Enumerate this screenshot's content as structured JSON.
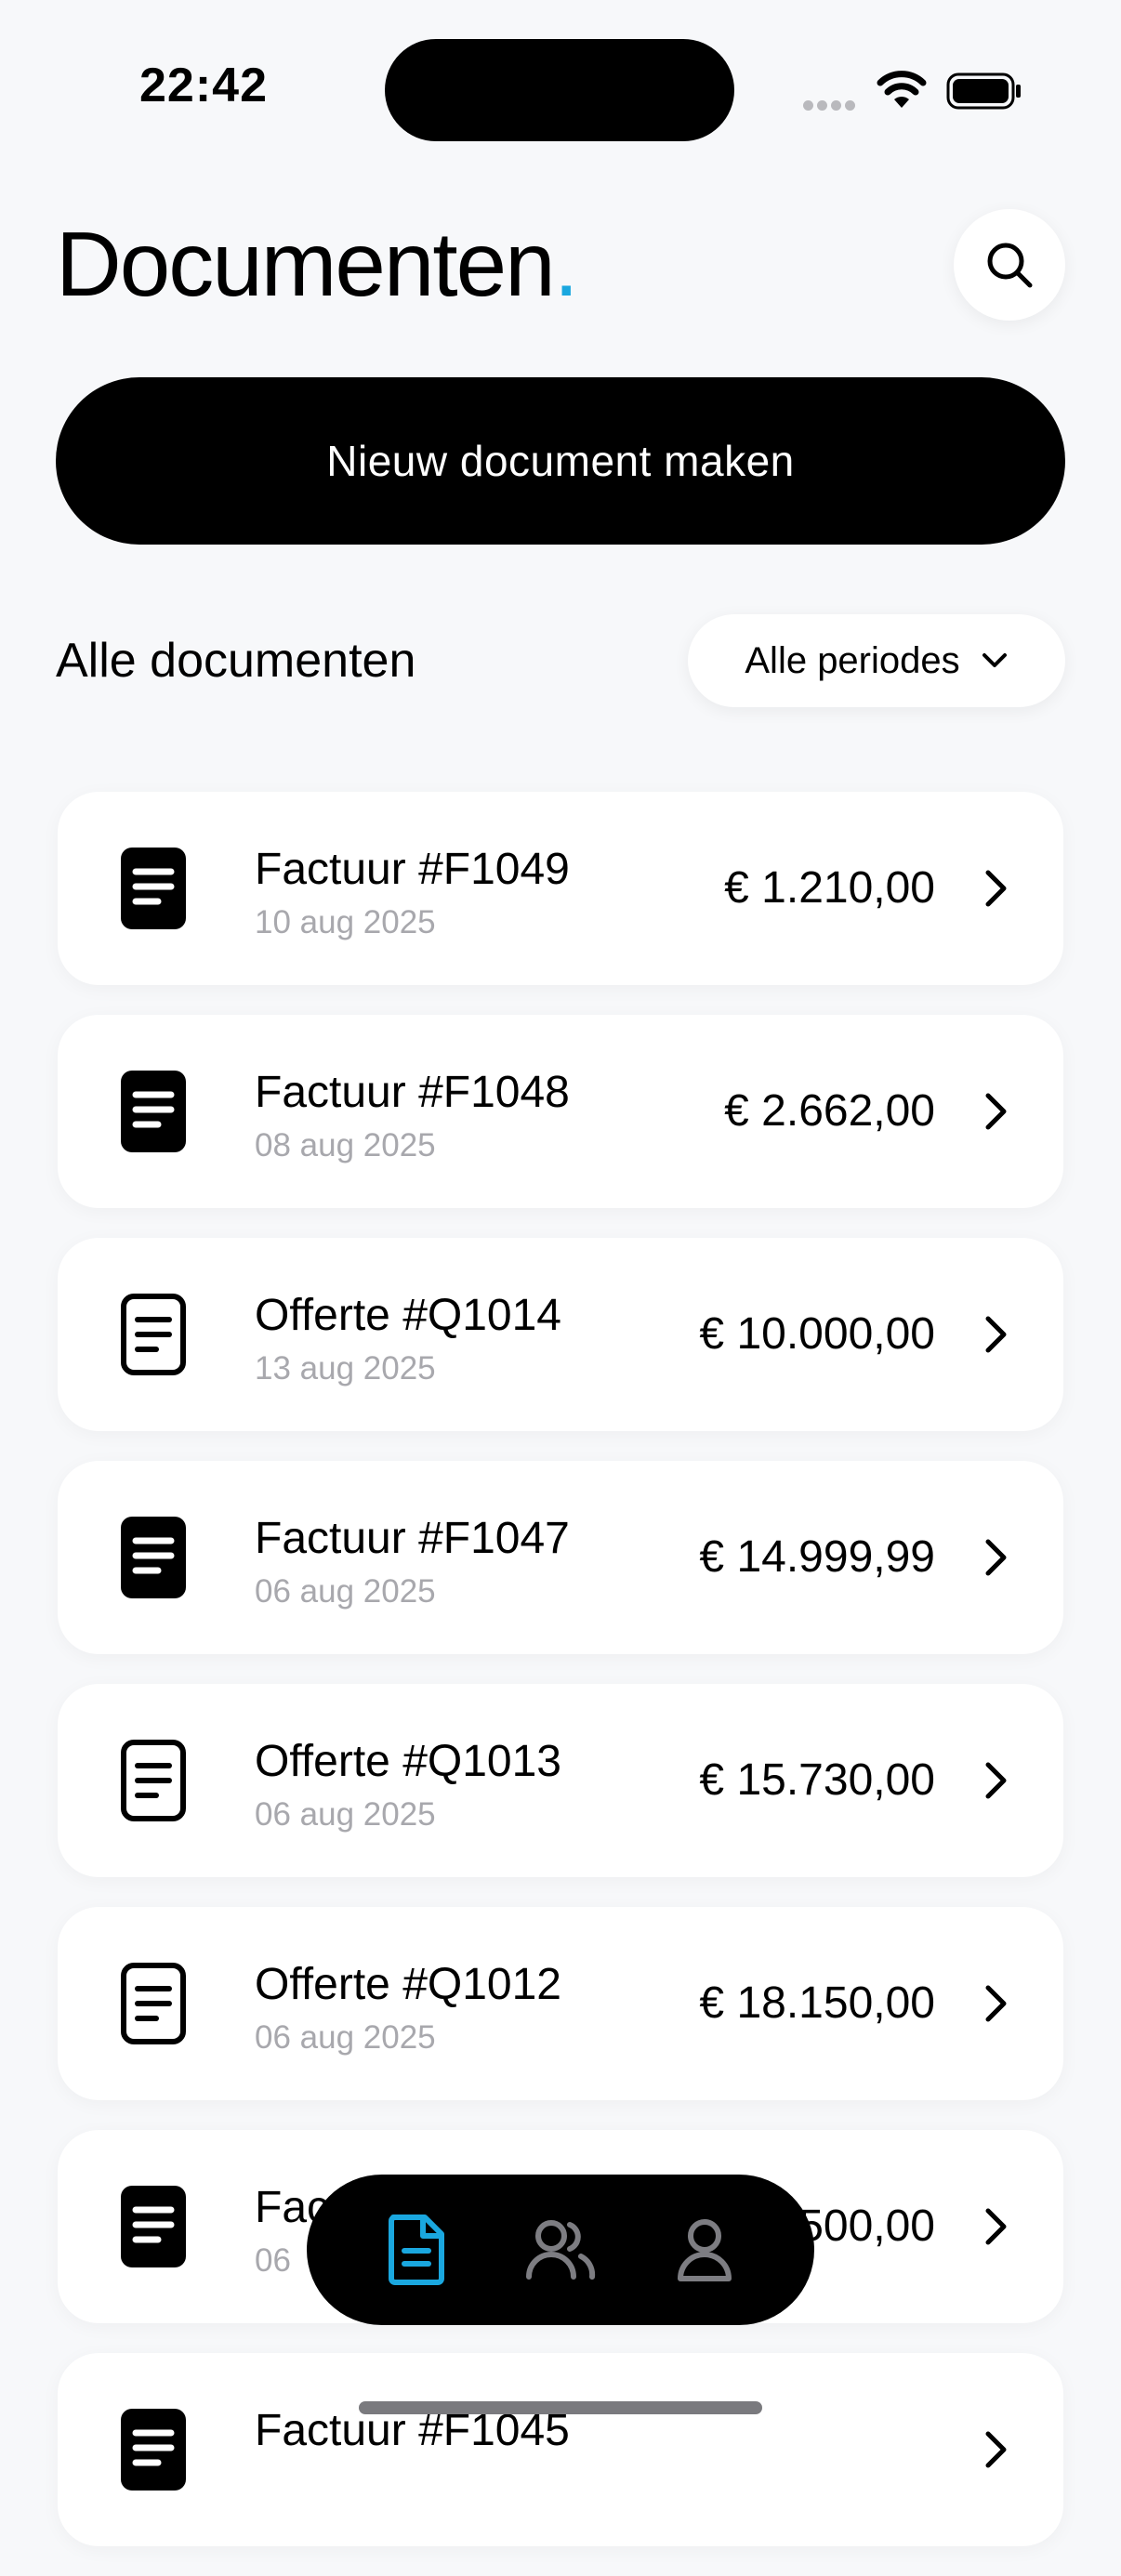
{
  "status_bar": {
    "time": "22:42"
  },
  "header": {
    "title": "Documenten",
    "title_dot": "."
  },
  "new_document": {
    "label": "Nieuw document maken"
  },
  "section": {
    "title": "Alle documenten",
    "period_filter": "Alle periodes"
  },
  "documents": [
    {
      "icon": "invoice-icon",
      "name": "Factuur #F1049",
      "date": "10 aug 2025",
      "amount": "€ 1.210,00"
    },
    {
      "icon": "invoice-icon",
      "name": "Factuur #F1048",
      "date": "08 aug 2025",
      "amount": "€ 2.662,00"
    },
    {
      "icon": "quote-icon",
      "name": "Offerte #Q1014",
      "date": "13 aug 2025",
      "amount": "€ 10.000,00"
    },
    {
      "icon": "invoice-icon",
      "name": "Factuur #F1047",
      "date": "06 aug 2025",
      "amount": "€ 14.999,99"
    },
    {
      "icon": "quote-icon",
      "name": "Offerte #Q1013",
      "date": "06 aug 2025",
      "amount": "€ 15.730,00"
    },
    {
      "icon": "quote-icon",
      "name": "Offerte #Q1012",
      "date": "06 aug 2025",
      "amount": "€ 18.150,00"
    },
    {
      "icon": "invoice-icon",
      "name": "Fac",
      "date": "06",
      "amount": "500,00"
    },
    {
      "icon": "invoice-icon",
      "name": "Factuur #F1045",
      "date": "",
      "amount": ""
    }
  ],
  "bottom_nav": [
    {
      "icon": "document-icon",
      "active": true
    },
    {
      "icon": "users-icon",
      "active": false
    },
    {
      "icon": "user-icon",
      "active": false
    }
  ],
  "colors": {
    "accent": "#1aa7df",
    "background": "#f7f8fa",
    "card": "#ffffff",
    "muted_text": "#a8a8ad"
  }
}
